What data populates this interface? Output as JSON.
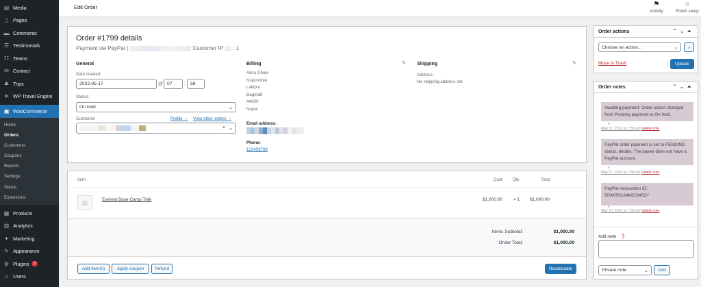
{
  "sidebar": {
    "top_items": [
      {
        "label": "Media",
        "icon": "media-icon"
      },
      {
        "label": "Pages",
        "icon": "pages-icon"
      },
      {
        "label": "Comments",
        "icon": "comments-icon"
      },
      {
        "label": "Testimonials",
        "icon": "testimonials-icon"
      },
      {
        "label": "Teams",
        "icon": "teams-icon"
      },
      {
        "label": "Contact",
        "icon": "contact-icon"
      },
      {
        "label": "Trips",
        "icon": "trips-icon"
      },
      {
        "label": "WP Travel Engine",
        "icon": "travel-engine-icon"
      }
    ],
    "active": {
      "label": "WooCommerce",
      "icon": "woocommerce-icon"
    },
    "sub_items": [
      "Home",
      "Orders",
      "Customers",
      "Coupons",
      "Reports",
      "Settings",
      "Status",
      "Extensions"
    ],
    "current_sub": "Orders",
    "bottom_items": [
      {
        "label": "Products",
        "icon": "products-icon"
      },
      {
        "label": "Analytics",
        "icon": "analytics-icon"
      },
      {
        "label": "Marketing",
        "icon": "marketing-icon"
      },
      {
        "label": "Appearance",
        "icon": "appearance-icon"
      },
      {
        "label": "Plugins",
        "icon": "plugins-icon",
        "badge": "3"
      },
      {
        "label": "Users",
        "icon": "users-icon"
      }
    ]
  },
  "topbar": {
    "title": "Edit Order",
    "activity_label": "Activity",
    "finish_label": "Finish setup"
  },
  "order": {
    "title": "Order #1799 details",
    "payment_prefix": "Payment via PayPal (",
    "customer_ip_label": "Customer IP:",
    "customer_ip_suffix": ": 1",
    "general": {
      "heading": "General",
      "date_label": "Date created:",
      "date_value": "2022-05-17",
      "at": "@",
      "hour": "07",
      "colon": ":",
      "minute": "58",
      "status_label": "Status:",
      "status_value": "On hold",
      "customer_label": "Customer:",
      "profile_link": "Profile →",
      "other_orders_link": "View other orders →",
      "clear": "×"
    },
    "billing": {
      "heading": "Billing",
      "address_lines": [
        "Alina Ghale",
        "Kupondole",
        "Lalitpur",
        "Bagmati",
        "44600",
        "Nepal"
      ],
      "email_label": "Email address:",
      "phone_label": "Phone:",
      "phone_value": "123456789"
    },
    "shipping": {
      "heading": "Shipping",
      "address_label": "Address:",
      "address_value": "No shipping address set."
    }
  },
  "items": {
    "headers": {
      "item": "Item",
      "cost": "Cost",
      "qty": "Qty",
      "total": "Total"
    },
    "rows": [
      {
        "name": "Everest Base Camp Trek",
        "cost": "$1,000.00",
        "qty": "× 1",
        "total": "$1,000.00"
      }
    ],
    "subtotal_label": "Items Subtotal:",
    "subtotal_value": "$1,000.00",
    "order_total_label": "Order Total:",
    "order_total_value": "$1,000.00",
    "buttons": {
      "add_items": "Add item(s)",
      "apply_coupon": "Apply coupon",
      "refund": "Refund",
      "recalculate": "Recalculate"
    }
  },
  "order_actions": {
    "title": "Order actions",
    "select_placeholder": "Choose an action...",
    "go": "›",
    "trash_link": "Move to Trash",
    "update_button": "Update"
  },
  "order_notes": {
    "title": "Order notes",
    "notes": [
      {
        "text": "Awaiting payment. Order status changed from Pending payment to On hold.",
        "date": "May 17, 2022 at 7:58 am",
        "delete": "Delete note"
      },
      {
        "text": "PayPal order payment is set to PENDING status, details: The payee does not have a PayPal account.",
        "date": "May 17, 2022 at 7:58 am",
        "delete": "Delete note"
      },
      {
        "text": "PayPal transaction ID: 50W050184M223452Y",
        "date": "May 17, 2022 at 7:58 am",
        "delete": "Delete note"
      }
    ],
    "add_note_label": "Add note",
    "note_type": "Private note",
    "add_button": "Add"
  },
  "colors": {
    "accent": "#2271b1",
    "sidebar_bg": "#1d2327",
    "note_bg": "#d7cad2",
    "delete_red": "#b32d2e"
  }
}
